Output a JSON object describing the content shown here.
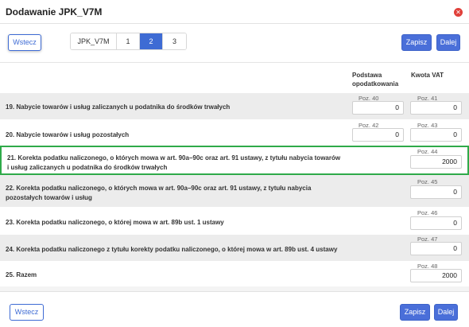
{
  "dialog": {
    "title": "Dodawanie JPK_V7M"
  },
  "toolbar": {
    "back_label": "Wstecz",
    "save_label": "Zapisz",
    "next_label": "Dalej",
    "tabs": [
      {
        "label": "JPK_V7M",
        "active": false
      },
      {
        "label": "1",
        "active": false
      },
      {
        "label": "2",
        "active": true
      },
      {
        "label": "3",
        "active": false
      }
    ]
  },
  "columns": {
    "base": "Podstawa opodatkowania",
    "vat": "Kwota VAT"
  },
  "rows": [
    {
      "label": "19. Nabycie towarów i usług zaliczanych u podatnika do środków trwałych",
      "base_poz": "Poz. 40",
      "base_value": "0",
      "vat_poz": "Poz. 41",
      "vat_value": "0"
    },
    {
      "label": "20. Nabycie towarów i usług pozostałych",
      "base_poz": "Poz. 42",
      "base_value": "0",
      "vat_poz": "Poz. 43",
      "vat_value": "0"
    },
    {
      "label": "21. Korekta podatku naliczonego, o których mowa w art. 90a–90c oraz art. 91 ustawy, z tytułu nabycia towarów i usług zaliczanych u podatnika do środków trwałych",
      "vat_poz": "Poz. 44",
      "vat_value": "2000"
    },
    {
      "label": "22. Korekta podatku naliczonego, o których mowa w art. 90a–90c oraz art. 91 ustawy, z tytułu nabycia pozostałych towarów i usług",
      "vat_poz": "Poz. 45",
      "vat_value": "0"
    },
    {
      "label": "23. Korekta podatku naliczonego, o której mowa w art. 89b ust. 1 ustawy",
      "vat_poz": "Poz. 46",
      "vat_value": "0"
    },
    {
      "label": "24. Korekta podatku naliczonego z tytułu korekty podatku naliczonego, o której mowa w art. 89b ust. 4 ustawy",
      "vat_poz": "Poz. 47",
      "vat_value": "0"
    },
    {
      "label": "25. Razem",
      "vat_poz": "Poz. 48",
      "vat_value": "2000"
    }
  ],
  "footer": {
    "back_label": "Wstecz",
    "save_label": "Zapisz",
    "next_label": "Dalej"
  },
  "colors": {
    "primary": "#4a6fd9",
    "highlight_border": "#2faa4a",
    "close": "#e0403a"
  }
}
